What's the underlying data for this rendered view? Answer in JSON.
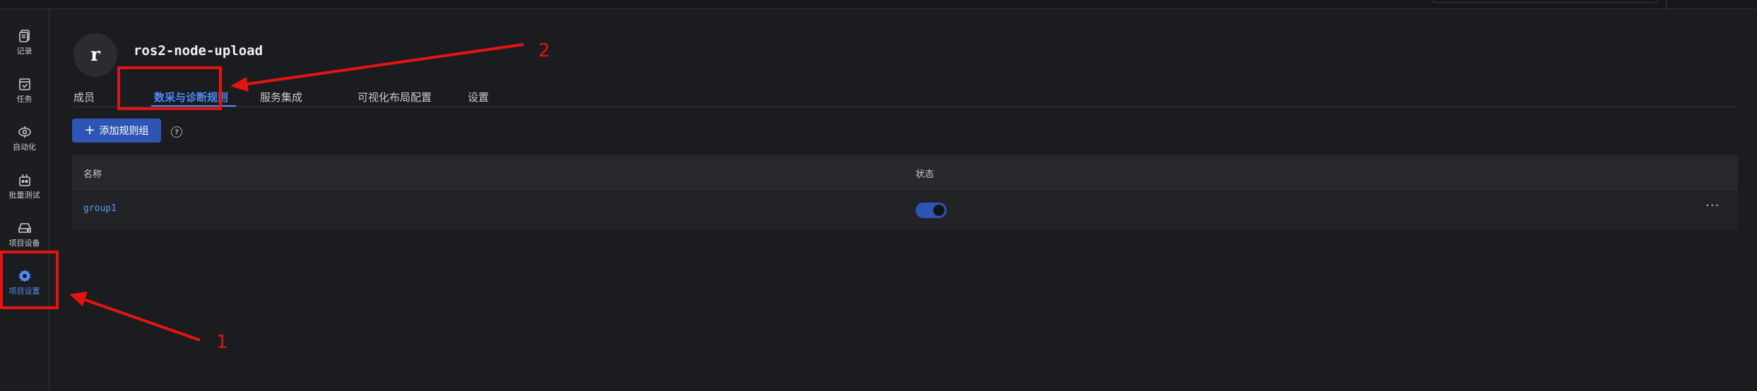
{
  "sidebar": {
    "items": [
      {
        "label": "记录",
        "icon": "document-icon"
      },
      {
        "label": "任务",
        "icon": "task-icon"
      },
      {
        "label": "自动化",
        "icon": "automation-icon"
      },
      {
        "label": "批量测试",
        "icon": "batch-test-icon"
      },
      {
        "label": "项目设备",
        "icon": "device-icon"
      },
      {
        "label": "项目设置",
        "icon": "gear-icon",
        "active": true
      }
    ]
  },
  "project": {
    "avatar_letter": "r",
    "name": "ros2-node-upload"
  },
  "tabs": [
    {
      "label": "成员"
    },
    {
      "label": "数采与诊断规则",
      "active": true
    },
    {
      "label": "服务集成"
    },
    {
      "label": "可视化布局配置"
    },
    {
      "label": "设置"
    }
  ],
  "toolbar": {
    "add_label": "添加规则组",
    "help_icon": "?"
  },
  "table": {
    "columns": [
      "名称",
      "状态"
    ],
    "rows": [
      {
        "name": "group1",
        "enabled": true,
        "more": "···"
      }
    ]
  },
  "annotations": [
    "1",
    "2"
  ],
  "colors": {
    "accent": "#4d8cf5",
    "button": "#2d56b4",
    "annotation": "#e51414",
    "background": "#1b1c1f"
  }
}
